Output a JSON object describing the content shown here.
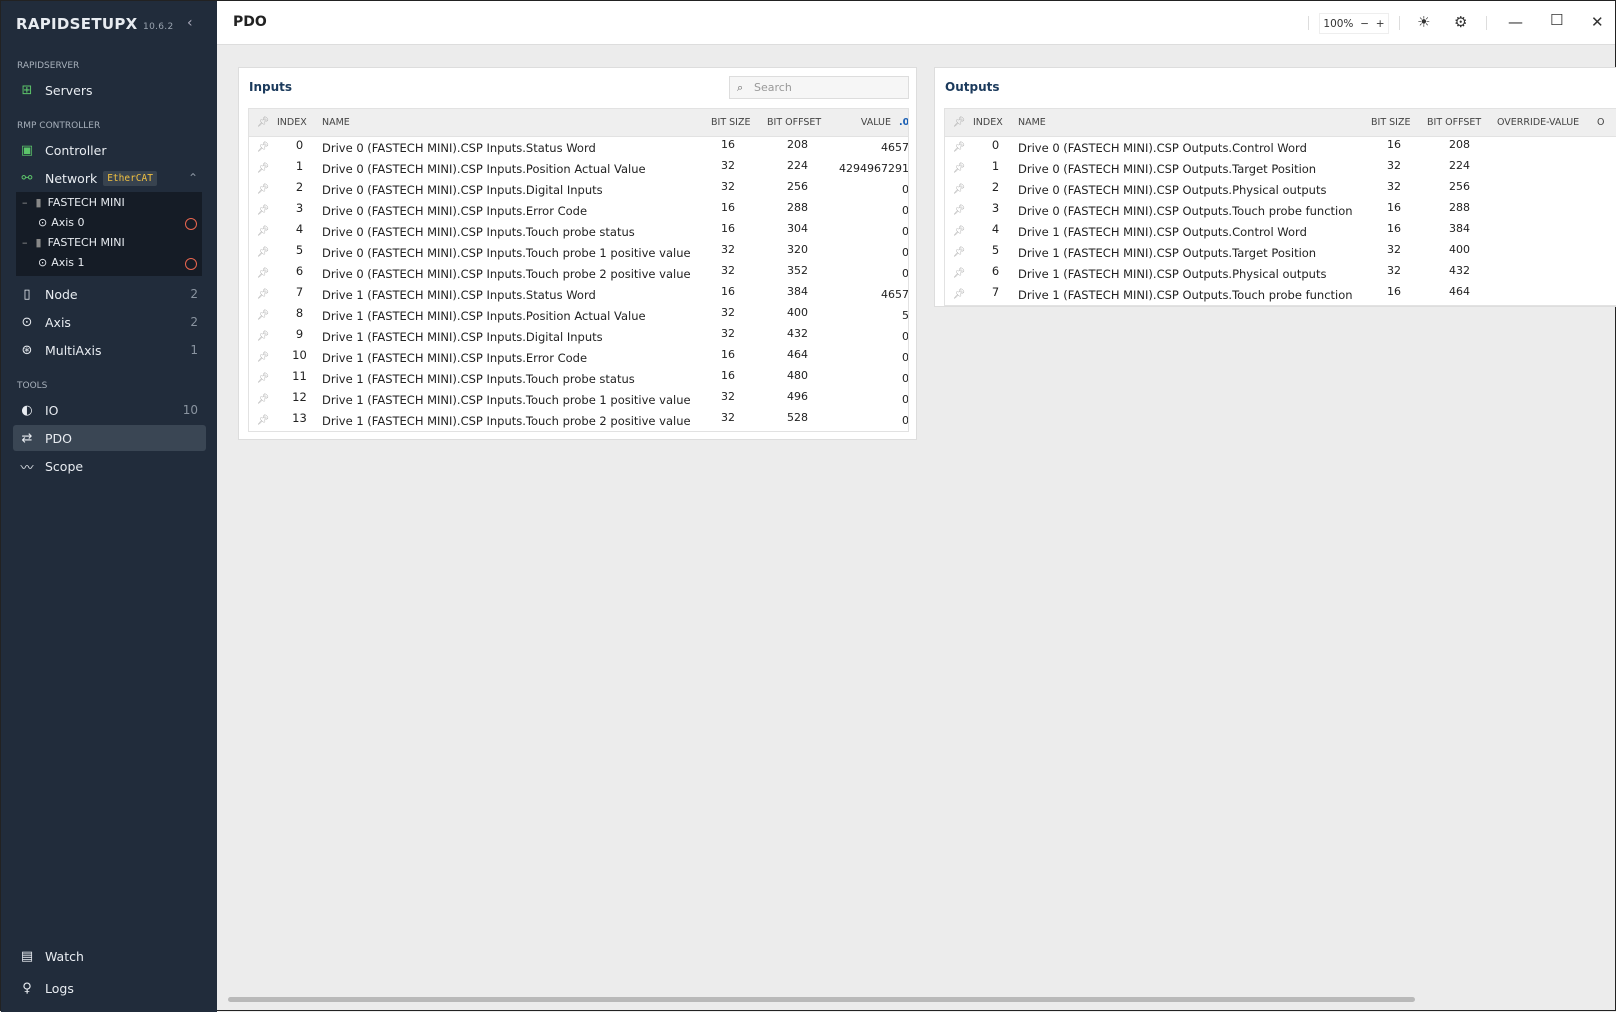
{
  "app": {
    "name": "RAPIDSETUPX",
    "version": "10.6.2"
  },
  "sidebar": {
    "sections": {
      "rapidserver": "RAPIDSERVER",
      "rmp": "RMP CONTROLLER",
      "tools": "TOOLS"
    },
    "servers": "Servers",
    "controller": "Controller",
    "network": "Network",
    "network_badge": "EtherCAT",
    "tree": [
      {
        "node": "FASTECH MINI",
        "axis": "Axis 0"
      },
      {
        "node": "FASTECH MINI",
        "axis": "Axis 1"
      }
    ],
    "node": {
      "label": "Node",
      "count": "2"
    },
    "axis": {
      "label": "Axis",
      "count": "2"
    },
    "multiaxis": {
      "label": "MultiAxis",
      "count": "1"
    },
    "io": {
      "label": "IO",
      "count": "10"
    },
    "pdo": "PDO",
    "scope": "Scope",
    "watch": "Watch",
    "logs": "Logs"
  },
  "header": {
    "title": "PDO",
    "zoom": "100%",
    "zoom_minus": "−",
    "zoom_plus": "+"
  },
  "inputs": {
    "title": "Inputs",
    "search_placeholder": "Search",
    "columns": {
      "index": "INDEX",
      "name": "NAME",
      "bit_size": "BIT SIZE",
      "bit_offset": "BIT OFFSET",
      "value": "VALUE",
      "format": ".00"
    },
    "rows": [
      [
        "0",
        "Drive 0 (FASTECH MINI).CSP Inputs.Status Word",
        "16",
        "208",
        "4657"
      ],
      [
        "1",
        "Drive 0 (FASTECH MINI).CSP Inputs.Position Actual Value",
        "32",
        "224",
        "4294967291"
      ],
      [
        "2",
        "Drive 0 (FASTECH MINI).CSP Inputs.Digital Inputs",
        "32",
        "256",
        "0"
      ],
      [
        "3",
        "Drive 0 (FASTECH MINI).CSP Inputs.Error Code",
        "16",
        "288",
        "0"
      ],
      [
        "4",
        "Drive 0 (FASTECH MINI).CSP Inputs.Touch probe status",
        "16",
        "304",
        "0"
      ],
      [
        "5",
        "Drive 0 (FASTECH MINI).CSP Inputs.Touch probe 1 positive value",
        "32",
        "320",
        "0"
      ],
      [
        "6",
        "Drive 0 (FASTECH MINI).CSP Inputs.Touch probe 2 positive value",
        "32",
        "352",
        "0"
      ],
      [
        "7",
        "Drive 1 (FASTECH MINI).CSP Inputs.Status Word",
        "16",
        "384",
        "4657"
      ],
      [
        "8",
        "Drive 1 (FASTECH MINI).CSP Inputs.Position Actual Value",
        "32",
        "400",
        "5"
      ],
      [
        "9",
        "Drive 1 (FASTECH MINI).CSP Inputs.Digital Inputs",
        "32",
        "432",
        "0"
      ],
      [
        "10",
        "Drive 1 (FASTECH MINI).CSP Inputs.Error Code",
        "16",
        "464",
        "0"
      ],
      [
        "11",
        "Drive 1 (FASTECH MINI).CSP Inputs.Touch probe status",
        "16",
        "480",
        "0"
      ],
      [
        "12",
        "Drive 1 (FASTECH MINI).CSP Inputs.Touch probe 1 positive value",
        "32",
        "496",
        "0"
      ],
      [
        "13",
        "Drive 1 (FASTECH MINI).CSP Inputs.Touch probe 2 positive value",
        "32",
        "528",
        "0"
      ]
    ]
  },
  "outputs": {
    "title": "Outputs",
    "columns": {
      "index": "INDEX",
      "name": "NAME",
      "bit_size": "BIT SIZE",
      "bit_offset": "BIT OFFSET",
      "override": "OVERRIDE-VALUE",
      "value": "O"
    },
    "rows": [
      [
        "0",
        "Drive 0 (FASTECH MINI).CSP Outputs.Control Word",
        "16",
        "208"
      ],
      [
        "1",
        "Drive 0 (FASTECH MINI).CSP Outputs.Target Position",
        "32",
        "224"
      ],
      [
        "2",
        "Drive 0 (FASTECH MINI).CSP Outputs.Physical outputs",
        "32",
        "256"
      ],
      [
        "3",
        "Drive 0 (FASTECH MINI).CSP Outputs.Touch probe function",
        "16",
        "288"
      ],
      [
        "4",
        "Drive 1 (FASTECH MINI).CSP Outputs.Control Word",
        "16",
        "384"
      ],
      [
        "5",
        "Drive 1 (FASTECH MINI).CSP Outputs.Target Position",
        "32",
        "400"
      ],
      [
        "6",
        "Drive 1 (FASTECH MINI).CSP Outputs.Physical outputs",
        "32",
        "432"
      ],
      [
        "7",
        "Drive 1 (FASTECH MINI).CSP Outputs.Touch probe function",
        "16",
        "464"
      ]
    ]
  },
  "colors": {
    "sidebar": "#212c3b",
    "accent_green": "#5cc46a",
    "status_ring": "#e8664f",
    "badge_text": "#f0c040",
    "format_blue": "#1a5fb4"
  }
}
